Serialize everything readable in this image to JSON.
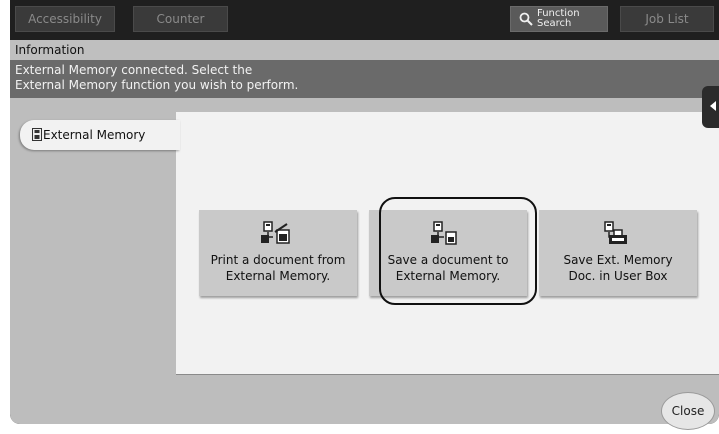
{
  "topbar": {
    "accessibility": "Accessibility",
    "counter": "Counter",
    "function_search_1": "Function",
    "function_search_2": "Search",
    "job_list": "Job List"
  },
  "info": {
    "title": "Information",
    "message_line1": "External Memory connected. Select the",
    "message_line2": "External Memory function you wish to perform."
  },
  "tab": {
    "label": "External Memory"
  },
  "actions": [
    {
      "line1": "Print a document from",
      "line2": "External Memory."
    },
    {
      "line1": "Save a document to",
      "line2": "External Memory."
    },
    {
      "line1": "Save Ext. Memory",
      "line2": "Doc. in User Box"
    }
  ],
  "close_label": "Close",
  "colors": {
    "background": "#2b2b2b",
    "panel": "#f2f2f2",
    "button": "#c9c9c9"
  },
  "icons": [
    "search-icon",
    "usb-memory-icon",
    "print-from-memory-icon",
    "save-to-memory-icon",
    "save-to-userbox-icon",
    "arrow-left-icon"
  ]
}
